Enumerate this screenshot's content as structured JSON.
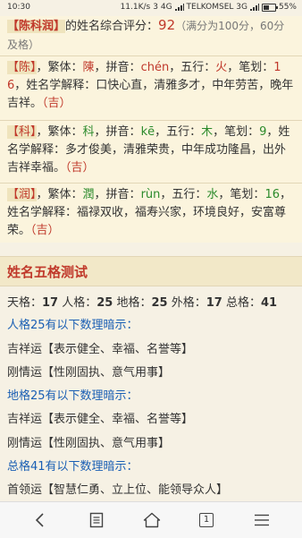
{
  "status": {
    "time": "10:30",
    "speed": "11.1K/s",
    "network": "3 4G",
    "carrier": "TELKOMSEL 3G",
    "battery": "55%"
  },
  "summary": {
    "name_bracket": "【陈科润】",
    "text1": "的姓名综合评分：",
    "score": "92",
    "text2": "（满分为100分，60分及格）"
  },
  "chars": [
    {
      "bracket": "【陈】",
      "trad_label": "，繁体：",
      "trad": "陳",
      "pinyin_label": "，拼音：",
      "pinyin": "chén",
      "wuxing_label": "，五行：",
      "wuxing": "火",
      "strokes_label": "，笔划：",
      "strokes": "16",
      "meaning": "，姓名学解释：口快心直，清雅多才，中年劳苦，晚年吉祥。",
      "luck": "（吉）"
    },
    {
      "bracket": "【科】",
      "trad_label": "，繁体：",
      "trad": "科",
      "pinyin_label": "，拼音：",
      "pinyin": "kē",
      "wuxing_label": "，五行：",
      "wuxing": "木",
      "strokes_label": "，笔划：",
      "strokes": "9",
      "meaning": "，姓名学解释：多才俊美，清雅荣贵，中年成功隆昌，出外吉祥幸福。",
      "luck": "（吉）"
    },
    {
      "bracket": "【润】",
      "trad_label": "，繁体：",
      "trad": "潤",
      "pinyin_label": "，拼音：",
      "pinyin": "rùn",
      "wuxing_label": "，五行：",
      "wuxing": "水",
      "strokes_label": "，笔划：",
      "strokes": "16",
      "meaning": "，姓名学解释：福禄双收，福寿兴家，环境良好，安富尊荣。",
      "luck": "（吉）"
    }
  ],
  "wuge": {
    "title": "姓名五格测试",
    "scores_line": {
      "tian_label": "天格：",
      "tian": "17",
      "ren_label": "人格：",
      "ren": "25",
      "di_label": "地格：",
      "di": "25",
      "wai_label": "外格：",
      "wai": "17",
      "zong_label": "总格：",
      "zong": "41"
    },
    "lines": [
      {
        "text": "人格25有以下数理暗示：",
        "style": "blue"
      },
      {
        "text": "吉祥运【表示健全、幸福、名誉等】",
        "style": "dark"
      },
      {
        "text": "刚情运【性刚固执、意气用事】",
        "style": "dark"
      },
      {
        "text": "地格25有以下数理暗示：",
        "style": "blue"
      },
      {
        "text": "吉祥运【表示健全、幸福、名誉等】",
        "style": "dark"
      },
      {
        "text": "刚情运【性刚固执、意气用事】",
        "style": "dark"
      },
      {
        "text": "总格41有以下数理暗示：",
        "style": "blue"
      },
      {
        "text": "首领运【智慧仁勇、立上位、能领导众人】",
        "style": "dark"
      }
    ]
  },
  "nav": {
    "tab_count": "1"
  }
}
